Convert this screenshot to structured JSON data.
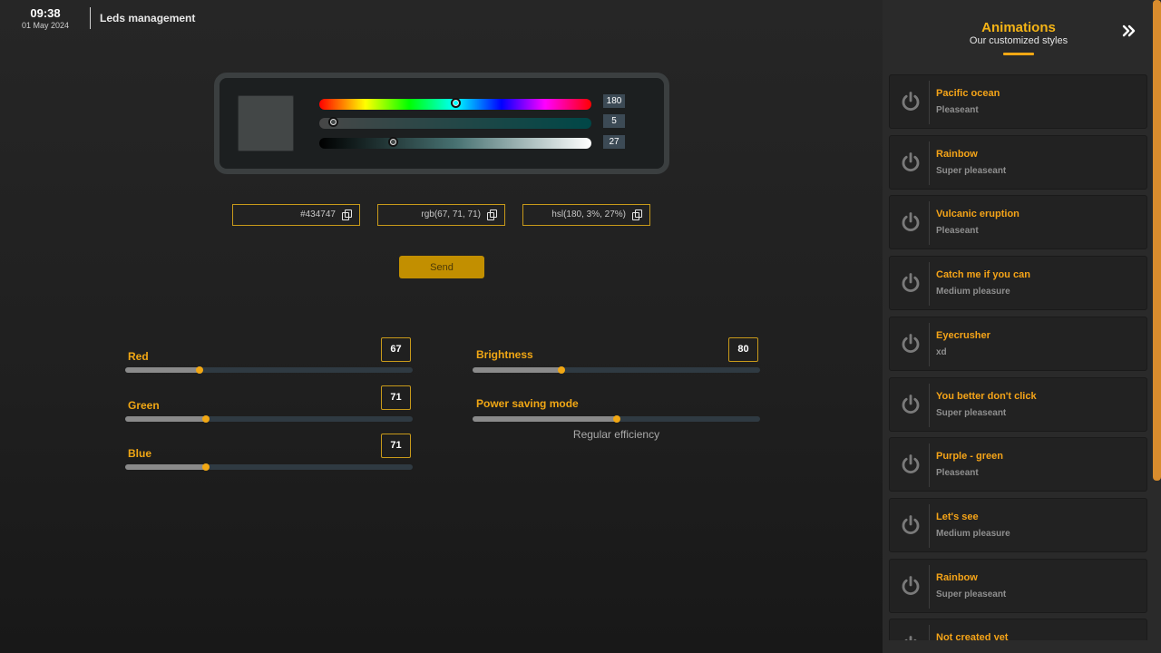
{
  "header": {
    "time": "09:38",
    "date": "01 May 2024",
    "title": "Leds management"
  },
  "picker": {
    "swatch_color": "#434747",
    "hue": {
      "value": "180",
      "fraction": 0.5
    },
    "saturation": {
      "value": "5",
      "fraction": 0.05
    },
    "lightness": {
      "value": "27",
      "fraction": 0.27
    }
  },
  "codes": {
    "hex": "#434747",
    "rgb": "rgb(67, 71, 71)",
    "hsl": "hsl(180, 3%, 27%)"
  },
  "send_label": "Send",
  "rgb_sliders": [
    {
      "label": "Red",
      "value": "67",
      "fraction": 0.26
    },
    {
      "label": "Green",
      "value": "71",
      "fraction": 0.28
    },
    {
      "label": "Blue",
      "value": "71",
      "fraction": 0.28
    }
  ],
  "brightness": {
    "label": "Brightness",
    "value": "80",
    "fraction": 0.31
  },
  "power_mode": {
    "label": "Power saving mode",
    "fraction": 0.5,
    "caption": "Regular efficiency"
  },
  "panel": {
    "title": "Animations",
    "subtitle": "Our customized styles",
    "items": [
      {
        "name": "Pacific ocean",
        "desc": "Pleaseant"
      },
      {
        "name": "Rainbow",
        "desc": "Super pleaseant"
      },
      {
        "name": "Vulcanic eruption",
        "desc": "Pleaseant"
      },
      {
        "name": "Catch me if you can",
        "desc": "Medium pleasure"
      },
      {
        "name": "Eyecrusher",
        "desc": "xd"
      },
      {
        "name": "You better don't click",
        "desc": "Super pleaseant"
      },
      {
        "name": "Purple - green",
        "desc": "Pleaseant"
      },
      {
        "name": "Let's see",
        "desc": "Medium pleasure"
      },
      {
        "name": "Rainbow",
        "desc": "Super pleaseant"
      },
      {
        "name": "Not created yet",
        "desc": ""
      }
    ]
  },
  "colors": {
    "accent": "#f1a714",
    "send_button": "#c28f00",
    "scrollbar": "#d98c2d"
  }
}
